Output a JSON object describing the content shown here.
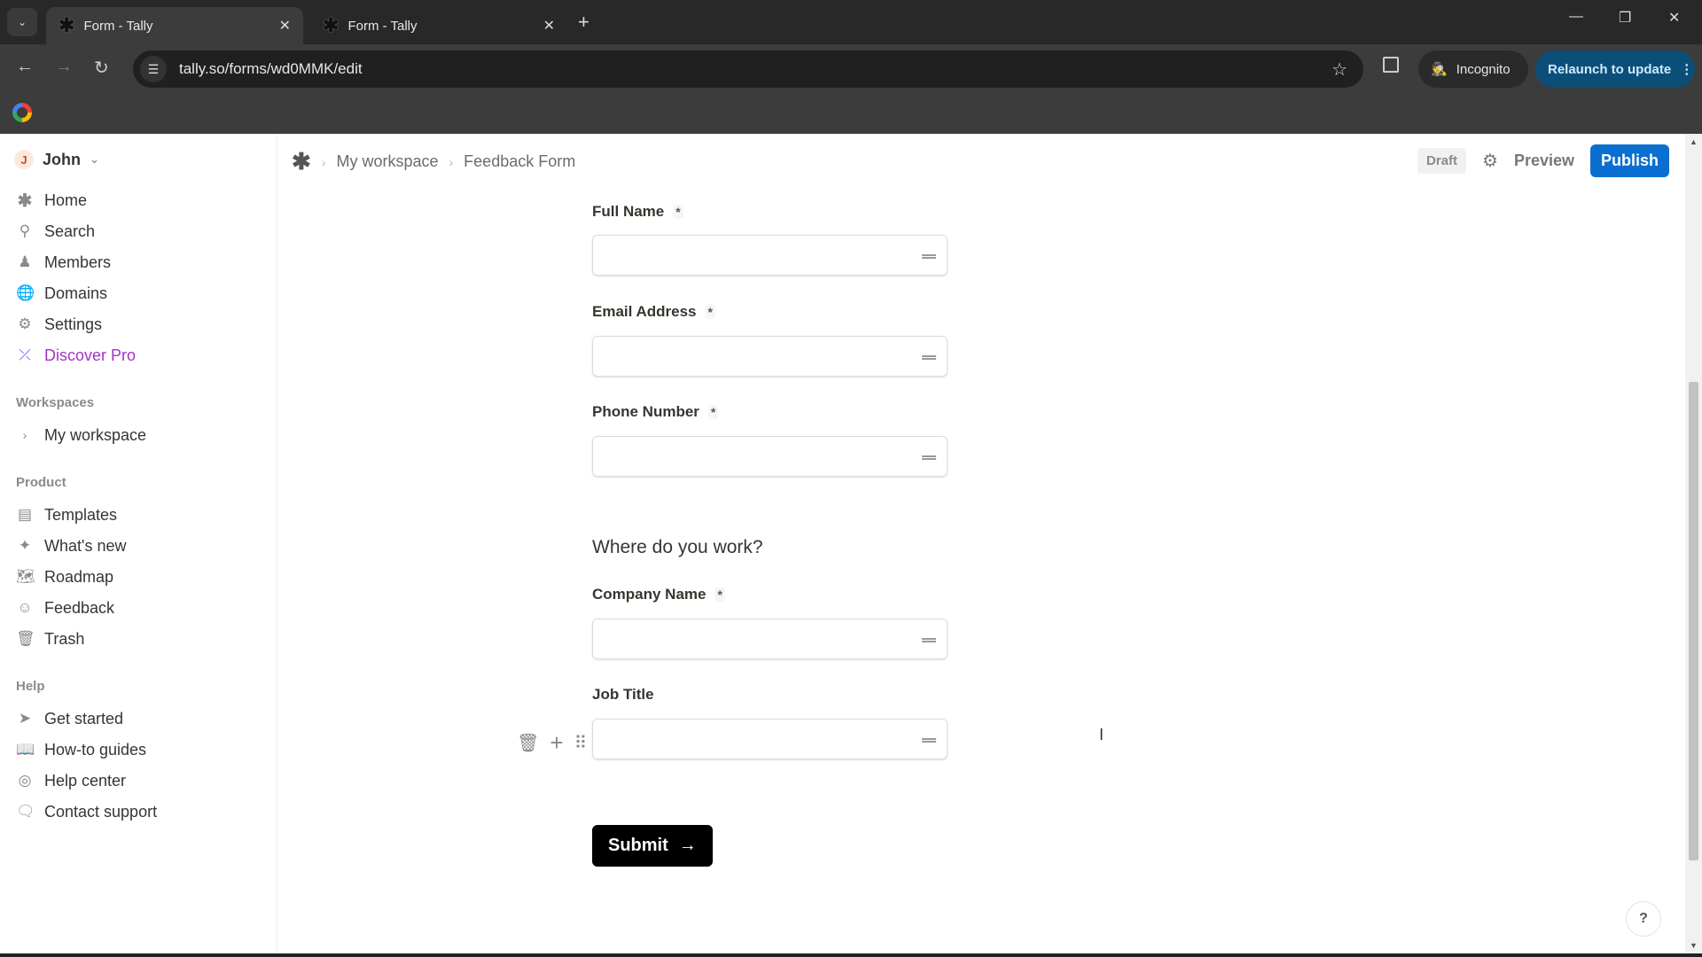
{
  "browser": {
    "tabs": [
      {
        "title": "Form - Tally",
        "active": true
      },
      {
        "title": "Form - Tally",
        "active": false
      }
    ],
    "url": "tally.so/forms/wd0MMK/edit",
    "incognito_label": "Incognito",
    "relaunch_label": "Relaunch to update"
  },
  "sidebar": {
    "user": {
      "initial": "J",
      "name": "John"
    },
    "items": [
      {
        "label": "Home",
        "icon": "tally-asterisk-icon"
      },
      {
        "label": "Search",
        "icon": "search-icon"
      },
      {
        "label": "Members",
        "icon": "members-icon"
      },
      {
        "label": "Domains",
        "icon": "globe-icon"
      },
      {
        "label": "Settings",
        "icon": "gear-icon"
      },
      {
        "label": "Discover Pro",
        "icon": "lightning-icon"
      }
    ],
    "workspaces_heading": "Workspaces",
    "workspace": "My workspace",
    "product_heading": "Product",
    "product_items": [
      {
        "label": "Templates",
        "icon": "templates-icon"
      },
      {
        "label": "What's new",
        "icon": "sparkle-icon"
      },
      {
        "label": "Roadmap",
        "icon": "map-icon"
      },
      {
        "label": "Feedback",
        "icon": "smiley-icon"
      },
      {
        "label": "Trash",
        "icon": "trash-icon"
      }
    ],
    "help_heading": "Help",
    "help_items": [
      {
        "label": "Get started",
        "icon": "send-icon"
      },
      {
        "label": "How-to guides",
        "icon": "book-icon"
      },
      {
        "label": "Help center",
        "icon": "lifebuoy-icon"
      },
      {
        "label": "Contact support",
        "icon": "chat-icon"
      }
    ]
  },
  "header": {
    "breadcrumb": [
      "My workspace",
      "Feedback Form"
    ],
    "status": "Draft",
    "preview_label": "Preview",
    "publish_label": "Publish",
    "publish_color": "#0a6fd1"
  },
  "form": {
    "fields": [
      {
        "label": "Full Name",
        "required": true,
        "value": ""
      },
      {
        "label": "Email Address",
        "required": true,
        "value": ""
      },
      {
        "label": "Phone Number",
        "required": true,
        "value": ""
      },
      {
        "label": "Company Name",
        "required": true,
        "value": ""
      },
      {
        "label": "Job Title",
        "required": false,
        "value": ""
      }
    ],
    "section_text": "Where do you work?",
    "required_mark": "*",
    "submit_label": "Submit"
  },
  "help_button": "?"
}
